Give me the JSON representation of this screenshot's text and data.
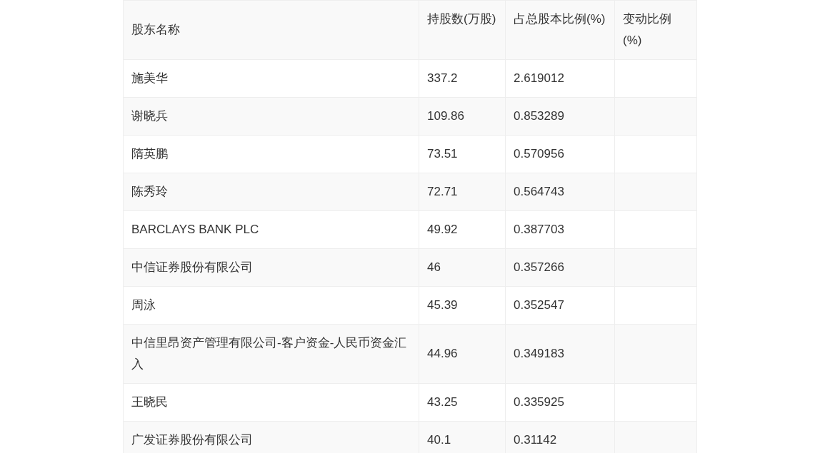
{
  "table": {
    "columns": [
      "股东名称",
      "持股数(万股)",
      "占总股本比例(%)",
      "变动比例(%)"
    ],
    "rows": [
      {
        "name": "施美华",
        "shares": "337.2",
        "ratio": "2.619012"
      },
      {
        "name": "谢晓兵",
        "shares": "109.86",
        "ratio": "0.853289"
      },
      {
        "name": "隋英鹏",
        "shares": "73.51",
        "ratio": "0.570956"
      },
      {
        "name": "陈秀玲",
        "shares": "72.71",
        "ratio": "0.564743"
      },
      {
        "name": "BARCLAYS BANK PLC",
        "shares": "49.92",
        "ratio": "0.387703"
      },
      {
        "name": "中信证券股份有限公司",
        "shares": "46",
        "ratio": "0.357266"
      },
      {
        "name": "周泳",
        "shares": "45.39",
        "ratio": "0.352547"
      },
      {
        "name": "中信里昂资产管理有限公司-客户资金-人民币资金汇入",
        "shares": "44.96",
        "ratio": "0.349183"
      },
      {
        "name": "王晓民",
        "shares": "43.25",
        "ratio": "0.335925"
      },
      {
        "name": "广发证券股份有限公司",
        "shares": "40.1",
        "ratio": "0.31142"
      }
    ]
  }
}
